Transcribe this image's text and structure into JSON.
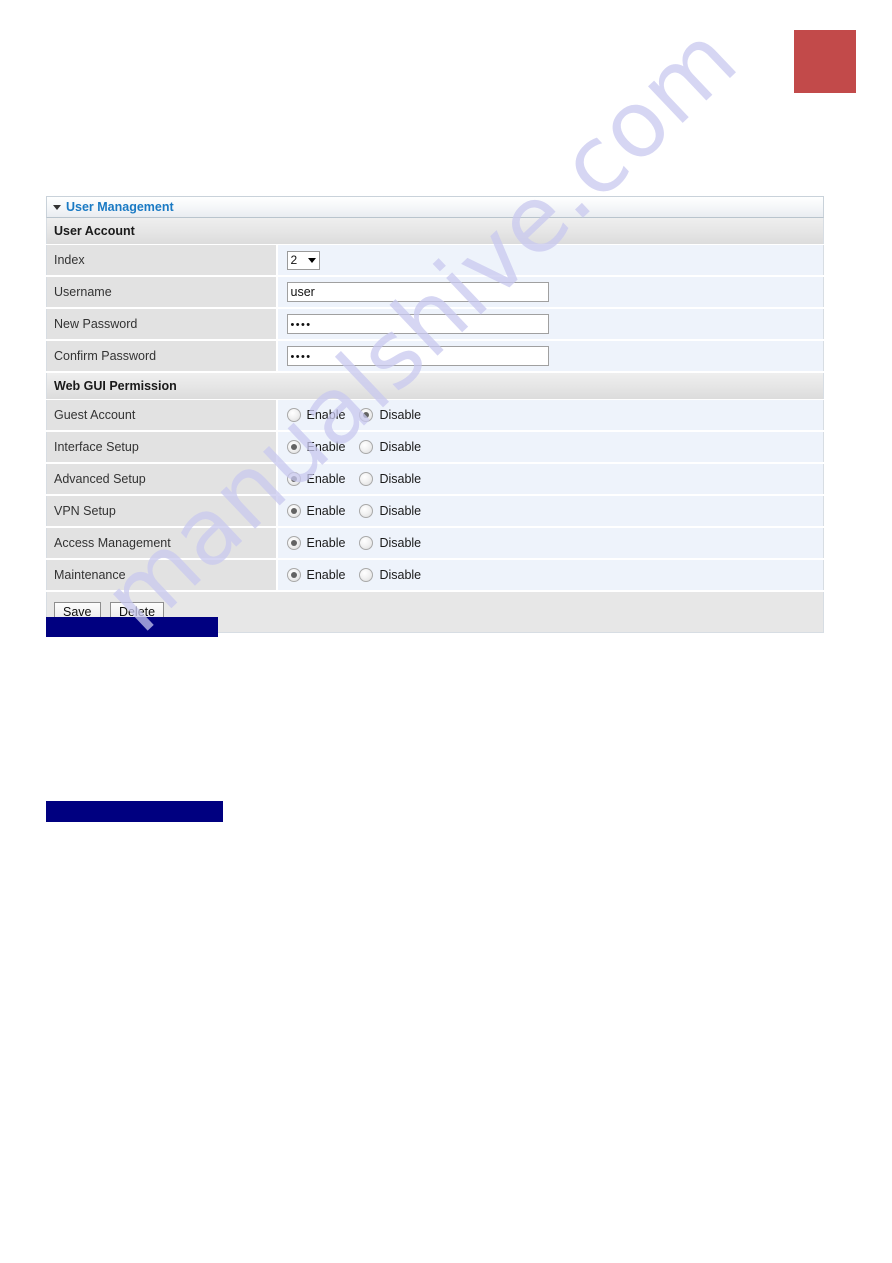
{
  "page": {
    "watermark": "manualshive.com",
    "accent_blue": "#1a7ac4",
    "redaction_color": "#000080",
    "corner_block_color": "#c24a4a"
  },
  "panel": {
    "title": "User Management",
    "collapse_icon": "triangle-down-icon"
  },
  "sections": {
    "user_account": {
      "heading": "User Account",
      "rows": [
        {
          "label": "Index",
          "type": "select",
          "value": "2"
        },
        {
          "label": "Username",
          "type": "text",
          "value": "user"
        },
        {
          "label": "New Password",
          "type": "password",
          "value": "••••"
        },
        {
          "label": "Confirm Password",
          "type": "password",
          "value": "••••"
        }
      ]
    },
    "web_gui_permission": {
      "heading": "Web GUI Permission",
      "option_enable": "Enable",
      "option_disable": "Disable",
      "rows": [
        {
          "label": "Guest Account",
          "selected": "Disable"
        },
        {
          "label": "Interface Setup",
          "selected": "Enable"
        },
        {
          "label": "Advanced Setup",
          "selected": "Enable"
        },
        {
          "label": "VPN Setup",
          "selected": "Enable"
        },
        {
          "label": "Access Management",
          "selected": "Enable"
        },
        {
          "label": "Maintenance",
          "selected": "Enable"
        }
      ]
    }
  },
  "actions": {
    "save_label": "Save",
    "delete_label": "Delete"
  }
}
